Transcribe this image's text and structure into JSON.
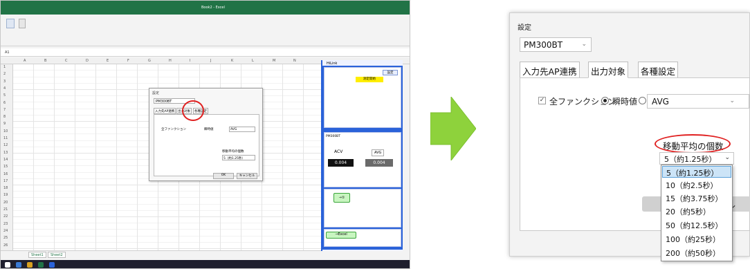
{
  "excel": {
    "title": "Book2 - Excel",
    "formula_cell": "A1",
    "columns": [
      "A",
      "B",
      "C",
      "D",
      "E",
      "F",
      "G",
      "H",
      "I",
      "J",
      "K",
      "L",
      "M",
      "N"
    ],
    "rows": [
      "1",
      "2",
      "3",
      "4",
      "5",
      "6",
      "7",
      "8",
      "9",
      "10",
      "11",
      "12",
      "13",
      "14",
      "15",
      "16",
      "17",
      "18",
      "19",
      "20",
      "21",
      "22",
      "23",
      "24",
      "25",
      "26"
    ],
    "sheet_tabs": [
      "Sheet1",
      "Sheet2"
    ],
    "mini_dialog": {
      "title": "設定",
      "model": "PM300BT",
      "tabs": [
        "入力先AP連携",
        "出力対象",
        "各種設定"
      ],
      "checkbox": "全ファンクション",
      "radio1": "瞬時値",
      "avg": "AVG",
      "ma_label": "移動平均の個数",
      "ma_value": "5（約1.25秒）",
      "ok": "OK",
      "cancel": "キャンセル"
    },
    "side_panel": {
      "title": "HiLink",
      "connect": "設定",
      "yellow": "測定開始",
      "device": "PM300BT",
      "acv": "ACV",
      "avg": "AVG",
      "value1": "0.004",
      "value2": "0.004",
      "green1": "→①",
      "green2": "→Excel"
    }
  },
  "dialog": {
    "title": "設定",
    "model_select": "PM300BT",
    "tabs": [
      "入力先AP連携",
      "出力対象",
      "各種設定"
    ],
    "all_functions_label": "全ファンクション",
    "all_functions_checked": true,
    "radio_instant_label": "瞬時値",
    "radio_instant_checked": true,
    "radio_other_checked": false,
    "avg_select": "AVG",
    "moving_average_label": "移動平均の個数",
    "moving_average_value": "5（約1.25秒）",
    "cancel_partial": "ル",
    "dropdown_options": [
      "5（約1.25秒）",
      "10（約2.5秒）",
      "15（約3.75秒）",
      "20（約5秒）",
      "50（約12.5秒）",
      "100（約25秒）",
      "200（約50秒）"
    ],
    "dropdown_selected_index": 0
  },
  "colors": {
    "excel_green": "#217346",
    "accent_blue": "#2a62d9",
    "highlight_red": "#e02020",
    "arrow_green": "#8ed23c",
    "selection_blue": "#cce4f7"
  }
}
